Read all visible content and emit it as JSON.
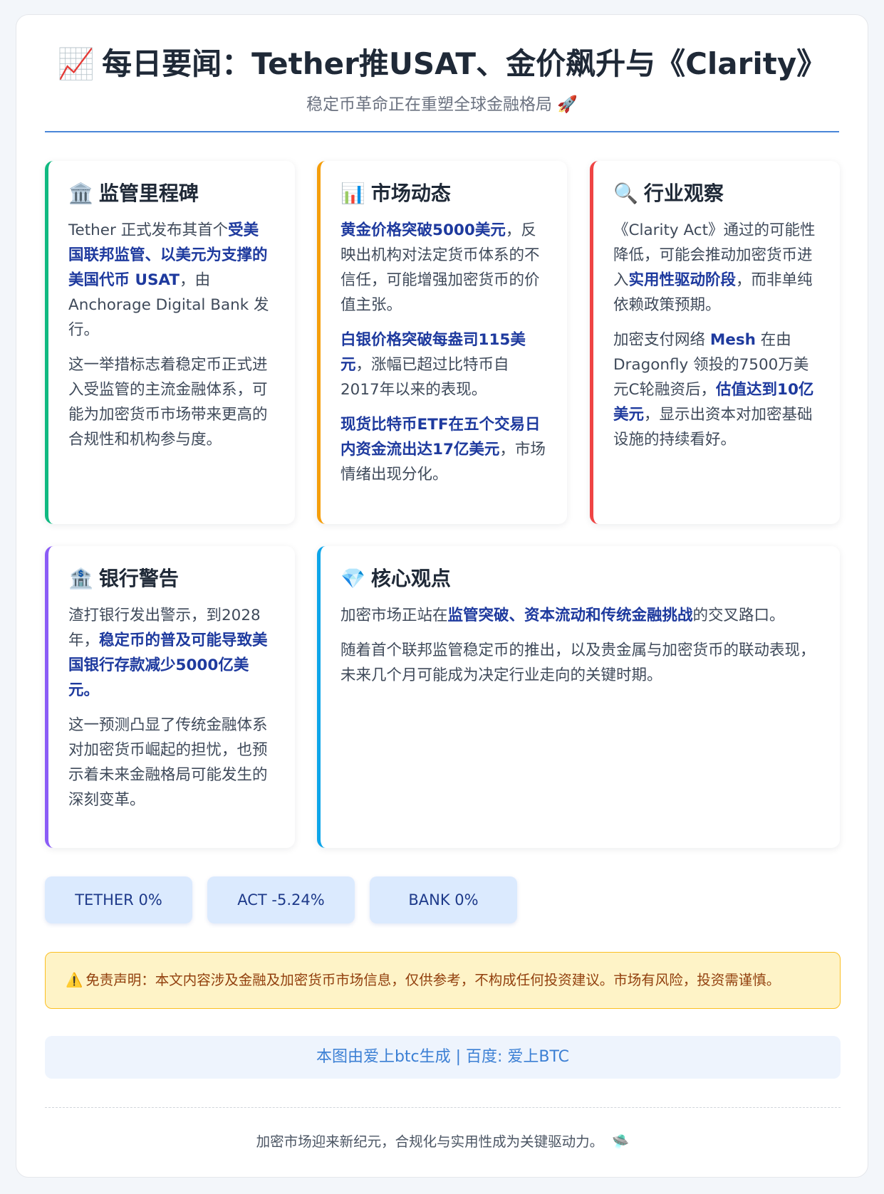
{
  "header": {
    "title_icon": "📈",
    "title": "每日要闻：Tether推USAT、金价飙升与《Clarity》",
    "subtitle": "稳定币革命正在重塑全球金融格局 🚀"
  },
  "cards": {
    "regulation": {
      "icon": "🏛️",
      "icon_name": "government-building-icon",
      "title": "监管里程碑",
      "p1": {
        "a": "Tether 正式发布其首个",
        "b": "受美国联邦监管、以美元为支撑的美国代币 USAT",
        "c": "，由 Anchorage Digital Bank 发行。"
      },
      "p2": "这一举措标志着稳定币正式进入受监管的主流金融体系，可能为加密货币市场带来更高的合规性和机构参与度。"
    },
    "market": {
      "icon": "📊",
      "icon_name": "bar-chart-icon",
      "title": "市场动态",
      "p1": {
        "a": "黄金价格突破5000美元",
        "b": "，反映出机构对法定货币体系的不信任，可能增强加密货币的价值主张。"
      },
      "p2": {
        "a": "白银价格突破每盎司115美元",
        "b": "，涨幅已超过比特币自2017年以来的表现。"
      },
      "p3": {
        "a": "现货比特币ETF在五个交易日内资金流出达17亿美元",
        "b": "，市场情绪出现分化。"
      }
    },
    "industry": {
      "icon": "🔍",
      "icon_name": "magnifier-icon",
      "title": "行业观察",
      "p1": {
        "a": "《Clarity Act》通过的可能性降低，可能会推动加密货币进入",
        "b": "实用性驱动阶段",
        "c": "，而非单纯依赖政策预期。"
      },
      "p2": {
        "a": "加密支付网络 ",
        "b": "Mesh",
        "c": " 在由 Dragonfly 领投的7500万美元C轮融资后，",
        "d": "估值达到10亿美元",
        "e": "，显示出资本对加密基础设施的持续看好。"
      }
    },
    "bank": {
      "icon": "🏦",
      "icon_name": "bank-icon",
      "title": "银行警告",
      "p1": {
        "a": "渣打银行发出警示，到2028年，",
        "b": "稳定币的普及可能导致美国银行存款减少5000亿美元",
        "c": "。"
      },
      "p2": "这一预测凸显了传统金融体系对加密货币崛起的担忧，也预示着未来金融格局可能发生的深刻变革。"
    },
    "core": {
      "icon": "💎",
      "icon_name": "gem-icon",
      "title": "核心观点",
      "p1": {
        "a": "加密市场正站在",
        "b": "监管突破、资本流动和传统金融挑战",
        "c": "的交叉路口。"
      },
      "p2": "随着首个联邦监管稳定币的推出，以及贵金属与加密货币的联动表现，未来几个月可能成为决定行业走向的关键时期。"
    }
  },
  "tickers": [
    {
      "label": "TETHER 0%"
    },
    {
      "label": "ACT -5.24%"
    },
    {
      "label": "BANK 0%"
    }
  ],
  "disclaimer": {
    "icon": "⚠️",
    "text": "免责声明：本文内容涉及金融及加密货币市场信息，仅供参考，不构成任何投资建议。市场有风险，投资需谨慎。"
  },
  "source": "本图由爱上btc生成 | 百度: 爱上BTC",
  "footer": {
    "text": "加密市场迎来新纪元，合规化与实用性成为关键驱动力。",
    "emoji": "🛸"
  },
  "colors": {
    "accent_blue": "#1e3a9e",
    "regulation_border": "#10b981",
    "market_border": "#f59e0b",
    "industry_border": "#ef4444",
    "bank_border": "#8b5cf6",
    "core_border": "#0ea5e9"
  }
}
